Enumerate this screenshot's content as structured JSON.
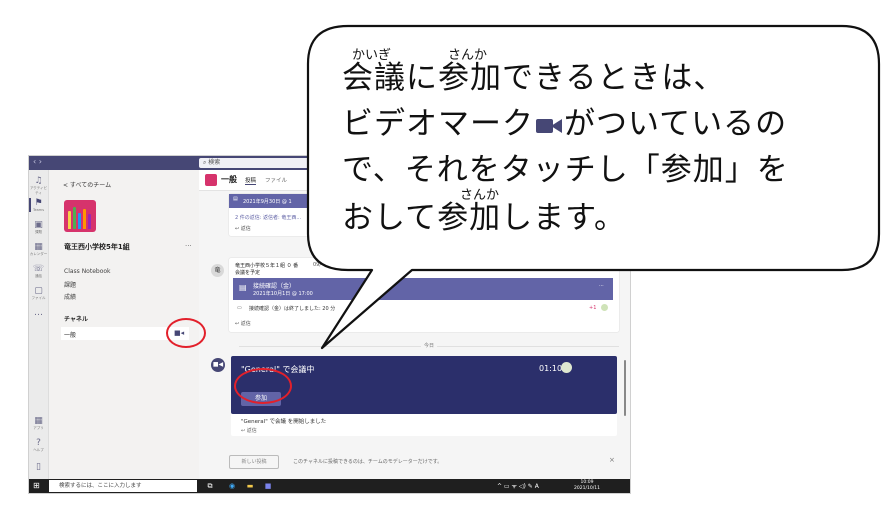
{
  "titlebar": {
    "nav": "‹ ›",
    "search_placeholder": "検索"
  },
  "rail": [
    {
      "icon": "bell-icon",
      "glyph": "♫",
      "label": "アクティビティ"
    },
    {
      "icon": "teams-icon",
      "glyph": "⚑",
      "label": "Teams"
    },
    {
      "icon": "assignments-icon",
      "glyph": "▣",
      "label": "課題"
    },
    {
      "icon": "calendar-icon",
      "glyph": "▦",
      "label": "カレンダー"
    },
    {
      "icon": "calls-icon",
      "glyph": "☏",
      "label": "通話"
    },
    {
      "icon": "files-icon",
      "glyph": "▢",
      "label": "ファイル"
    },
    {
      "icon": "more-icon",
      "glyph": "…",
      "label": ""
    },
    {
      "icon": "apps-icon",
      "glyph": "▦",
      "label": "アプリ"
    },
    {
      "icon": "help-icon",
      "glyph": "?",
      "label": "ヘルプ"
    },
    {
      "icon": "device-icon",
      "glyph": "▯",
      "label": ""
    }
  ],
  "panel": {
    "back": "< すべてのチーム",
    "team_name": "竜王西小学校5年1組",
    "more": "···",
    "links": [
      "Class Notebook",
      "課題",
      "成績"
    ],
    "channels_heading": "チャネル",
    "channel": "一般"
  },
  "main": {
    "title": "一般",
    "tab_posts": "投稿",
    "tab_files": "ファイル",
    "post1": {
      "date": "2021年9月30日 @ 1",
      "replies": "2 件の返信: 返信者: 竜王西...",
      "reply": "↩ 返信"
    },
    "post2": {
      "avatar": "竜",
      "author": "竜王西小学校５年１組 ０ 番",
      "time": "09/",
      "subject": "会議を予定",
      "band_title": "接続確認（金）",
      "band_date": "2021年10月1日 @ 17:00",
      "ended": "接続確認（金）は終了しました: 20 分",
      "reply": "↩ 返信",
      "more": "···",
      "participants": "+1"
    },
    "date_divider": "今日",
    "meeting": {
      "avatar": "■◀",
      "title": "\"General\" で会議中",
      "duration": "01:10",
      "join": "参加",
      "started": "\"General\" で会議 を開始しました",
      "reply": "↩ 返信"
    },
    "compose": {
      "new_post": "新しい投稿",
      "notice": "このチャネルに投稿できるのは、チームのモデレーターだけです。",
      "close": "×"
    }
  },
  "taskbar": {
    "search": "検索するには、ここに入力します",
    "tray": "^ ▭ ᯤ ◁) ✎ A",
    "time": "10:09",
    "date": "2021/10/11"
  },
  "bubble": {
    "line1": "会議に参加できるときは、",
    "line2a": "ビデオマーク",
    "line2b": "がついているの",
    "line3": "で、それをタッチし「参加」を",
    "line4": "おして参加します。",
    "ruby_kaigi": "かいぎ",
    "ruby_sanka1": "さんか",
    "ruby_sanka2": "さんか"
  }
}
